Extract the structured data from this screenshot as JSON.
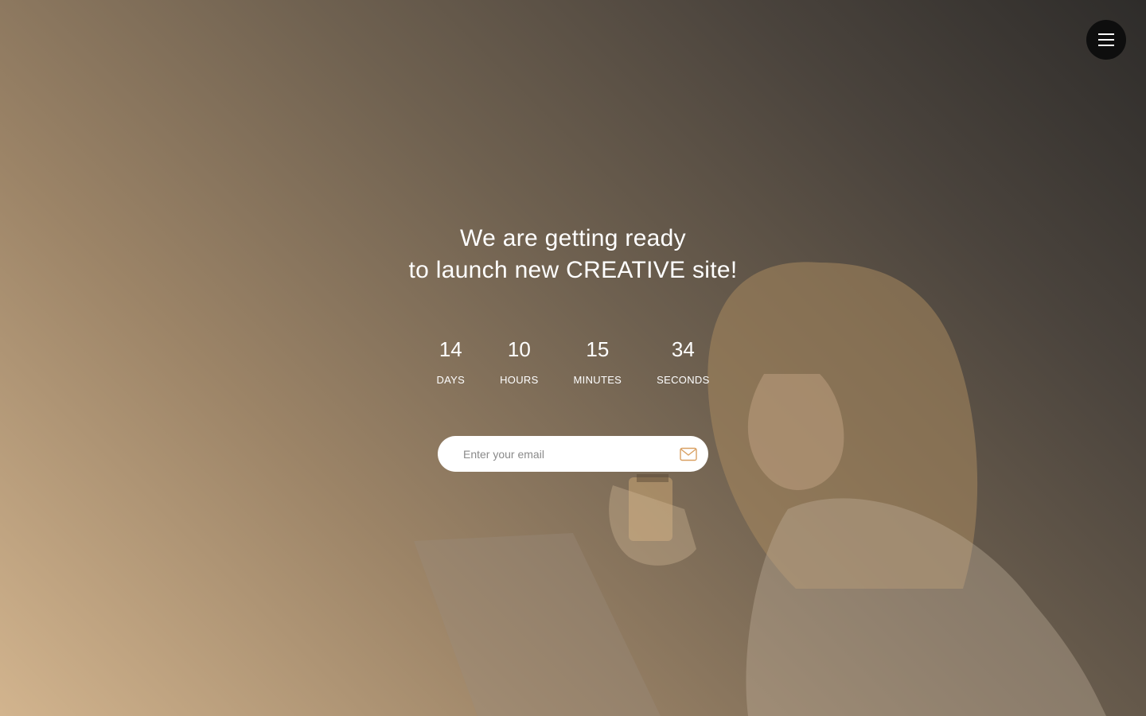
{
  "hero": {
    "headline_line1": "We are getting ready",
    "headline_line2": "to launch new CREATIVE site!"
  },
  "countdown": [
    {
      "value": "14",
      "label": "DAYS"
    },
    {
      "value": "10",
      "label": "HOURS"
    },
    {
      "value": "15",
      "label": "MINUTES"
    },
    {
      "value": "34",
      "label": "SECONDS"
    }
  ],
  "subscribe": {
    "placeholder": "Enter your email",
    "icon": "envelope-icon"
  },
  "menu": {
    "icon": "hamburger-menu-icon"
  },
  "colors": {
    "accent": "#d9a062",
    "menu_bg": "#0e0e0e",
    "text": "#ffffff"
  }
}
